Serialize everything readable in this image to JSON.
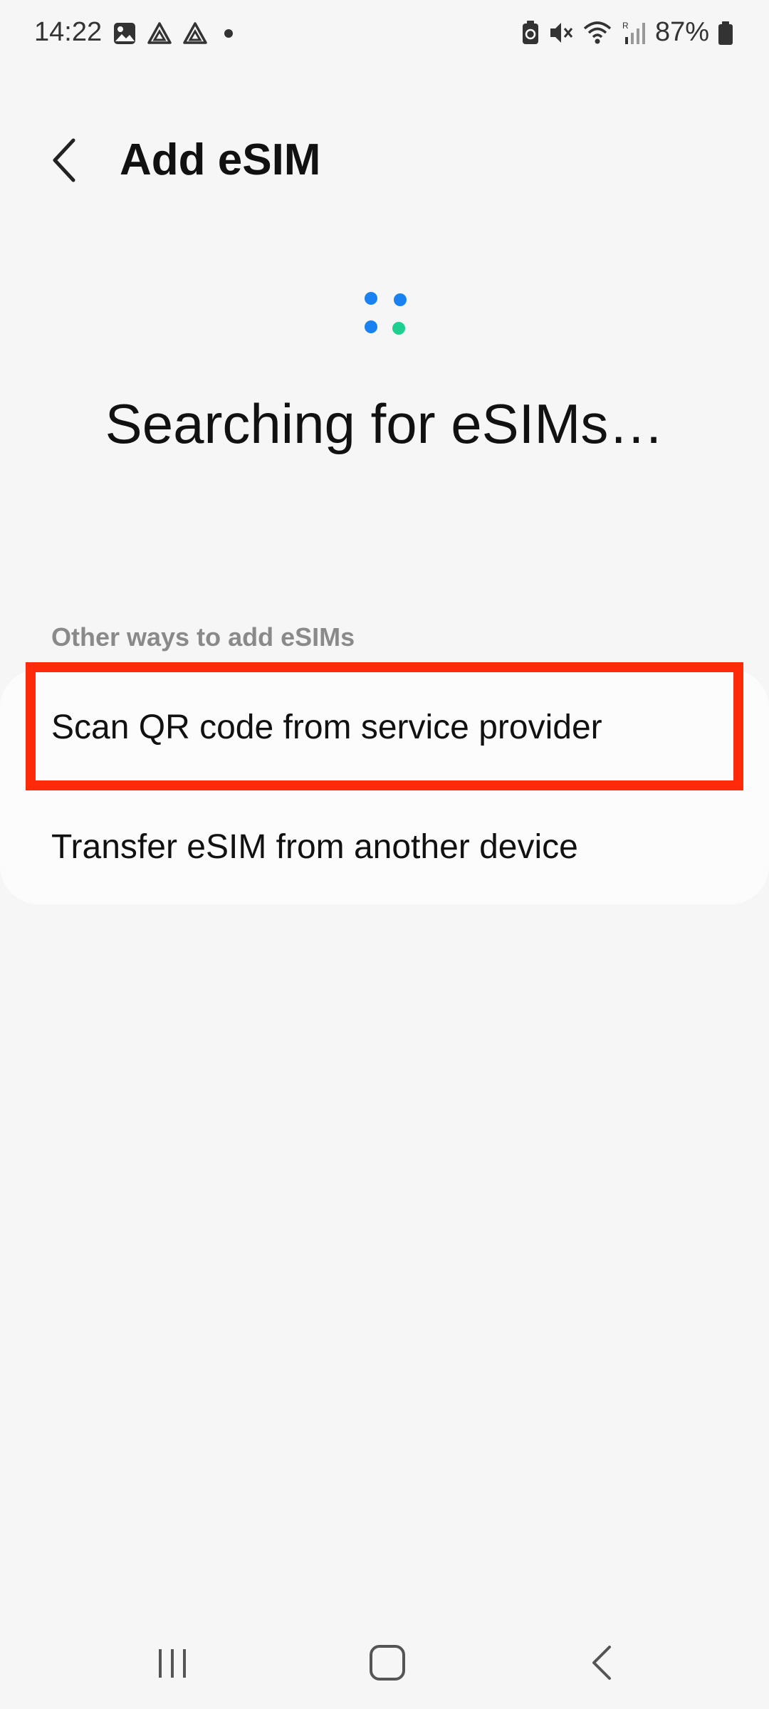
{
  "status_bar": {
    "time": "14:22",
    "battery": "87%",
    "left_icons": [
      "gallery-icon",
      "drive-icon",
      "drive-icon",
      "dot-icon"
    ],
    "right_icons": [
      "battery-saver-icon",
      "mute-icon",
      "wifi-icon",
      "signal-icon",
      "battery-icon"
    ]
  },
  "app_bar": {
    "title": "Add eSIM"
  },
  "main": {
    "status_text": "Searching for eSIMs…",
    "section_header": "Other ways to add eSIMs",
    "options": [
      {
        "label": "Scan QR code from service provider"
      },
      {
        "label": "Transfer eSIM from another device"
      }
    ]
  },
  "colors": {
    "spinner_blue": "#1a82f0",
    "spinner_green": "#1fcf8f",
    "highlight": "#ff2a0a",
    "background": "#f6f6f6"
  }
}
